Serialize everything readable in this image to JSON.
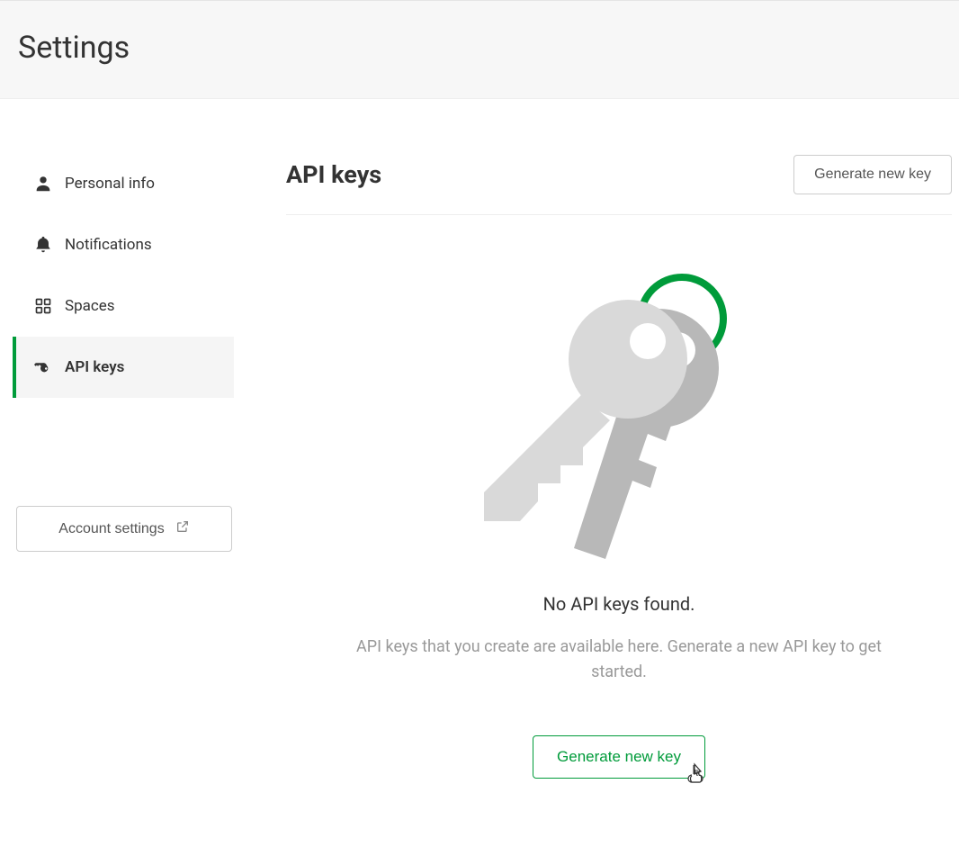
{
  "page": {
    "title": "Settings"
  },
  "sidebar": {
    "items": [
      {
        "label": "Personal info",
        "icon": "user-icon",
        "active": false
      },
      {
        "label": "Notifications",
        "icon": "bell-icon",
        "active": false
      },
      {
        "label": "Spaces",
        "icon": "grid-icon",
        "active": false
      },
      {
        "label": "API keys",
        "icon": "key-icon",
        "active": true
      }
    ],
    "account_settings_label": "Account settings"
  },
  "main": {
    "heading": "API keys",
    "generate_button_top": "Generate new key",
    "empty": {
      "title": "No API keys found.",
      "description": "API keys that you create are available here. Generate a new API key to get started.",
      "cta": "Generate new key"
    }
  },
  "colors": {
    "accent": "#009b3a"
  }
}
